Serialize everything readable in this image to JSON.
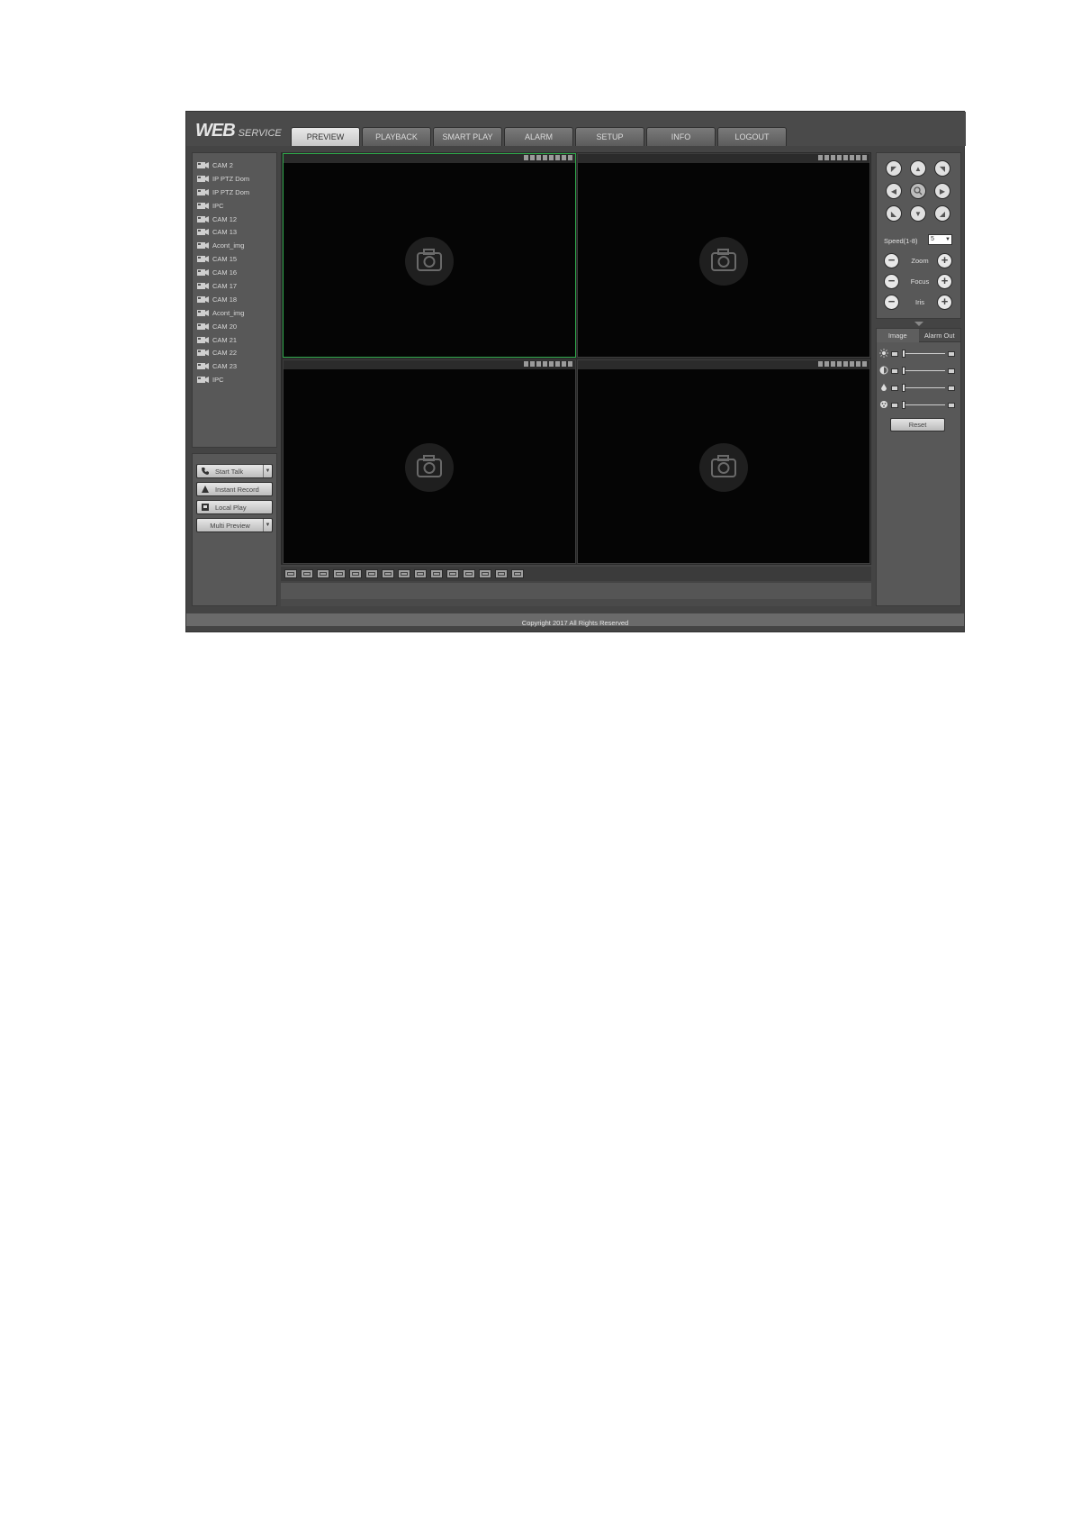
{
  "brand": {
    "main": "WEB",
    "sub": "SERVICE"
  },
  "tabs": [
    {
      "label": "PREVIEW",
      "active": true
    },
    {
      "label": "PLAYBACK"
    },
    {
      "label": "SMART PLAY"
    },
    {
      "label": "ALARM"
    },
    {
      "label": "SETUP"
    },
    {
      "label": "INFO"
    },
    {
      "label": "LOGOUT"
    }
  ],
  "channels": [
    "CAM 2",
    "IP PTZ Dom",
    "IP PTZ Dom",
    "IPC",
    "CAM 12",
    "CAM 13",
    "Acont_img",
    "CAM 15",
    "CAM 16",
    "CAM 17",
    "CAM 18",
    "Acont_img",
    "CAM 20",
    "CAM 21",
    "CAM 22",
    "CAM 23",
    "IPC"
  ],
  "actions": {
    "start_talk": "Start Talk",
    "instant_record": "Instant Record",
    "local_play": "Local Play",
    "multi_preview": "Multi Preview"
  },
  "ptz": {
    "speed_label": "Speed(1-8)",
    "speed_value": "5",
    "zoom_label": "Zoom",
    "focus_label": "Focus",
    "iris_label": "Iris"
  },
  "image_panel": {
    "tab_image": "Image",
    "tab_alarm_out": "Alarm Out",
    "reset_label": "Reset"
  },
  "footer": {
    "copyright": "Copyright 2017 All Rights Reserved"
  },
  "colors": {
    "selected_pane_border": "#2fa84a",
    "background": "#444444"
  }
}
